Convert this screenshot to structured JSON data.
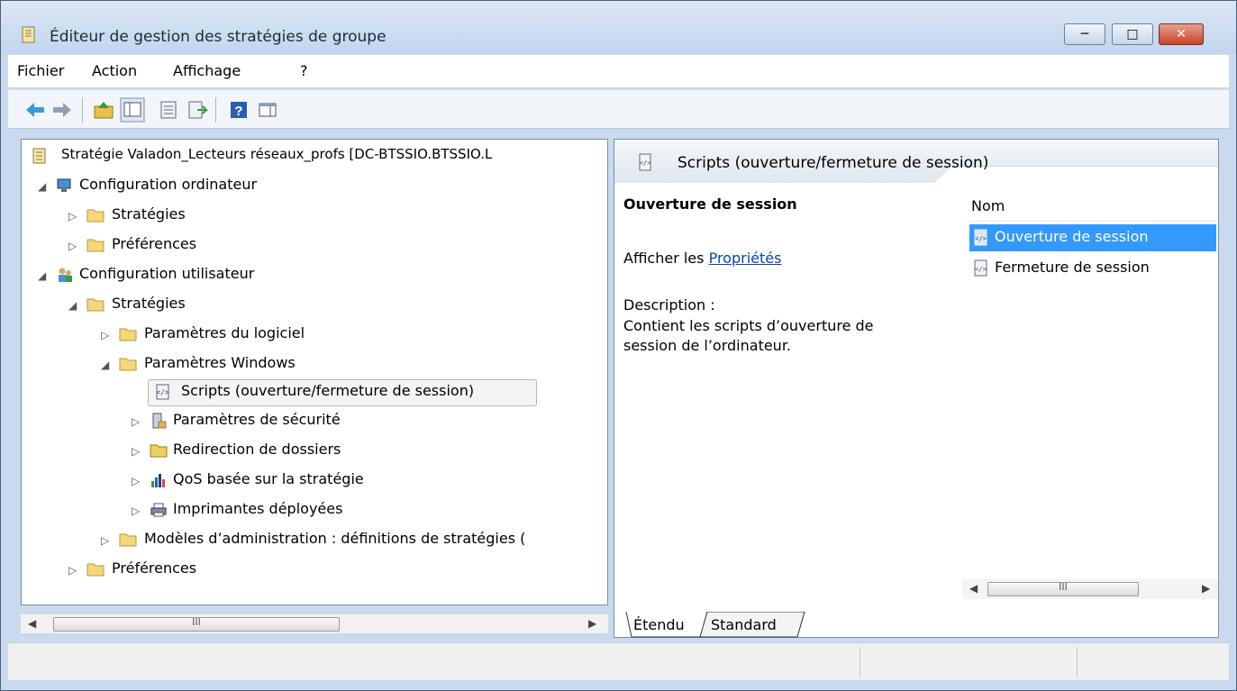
{
  "window": {
    "title": "Éditeur de gestion des stratégies de groupe",
    "controls": {
      "minimize": "─",
      "maximize": "□",
      "close": "✕"
    }
  },
  "menu": [
    "Fichier",
    "Action",
    "Affichage",
    "?"
  ],
  "toolbar": {
    "icons": [
      "back-arrow-icon",
      "forward-arrow-icon",
      "up-folder-icon",
      "show-hide-tree-icon",
      "properties-icon",
      "export-list-icon",
      "help-icon",
      "show-hide-action-pane-icon"
    ]
  },
  "tree": {
    "root": "Stratégie Valadon_Lecteurs réseaux_profs [DC-BTSSIO.BTSSIO.L",
    "nodes": [
      {
        "label": "Configuration ordinateur",
        "icon": "computer-config-icon",
        "expanded": true,
        "depth": 1
      },
      {
        "label": "Stratégies",
        "icon": "folder-icon",
        "expanded": false,
        "depth": 2
      },
      {
        "label": "Préférences",
        "icon": "folder-icon",
        "expanded": false,
        "depth": 2
      },
      {
        "label": "Configuration utilisateur",
        "icon": "user-config-icon",
        "expanded": true,
        "depth": 1
      },
      {
        "label": "Stratégies",
        "icon": "folder-icon",
        "expanded": true,
        "depth": 2
      },
      {
        "label": "Paramètres du logiciel",
        "icon": "folder-icon",
        "expanded": false,
        "depth": 3
      },
      {
        "label": "Paramètres Windows",
        "icon": "folder-icon",
        "expanded": true,
        "depth": 3
      },
      {
        "label": "Scripts (ouverture/fermeture de session)",
        "icon": "script-icon",
        "selected": true,
        "depth": 4
      },
      {
        "label": "Paramètres de sécurité",
        "icon": "security-icon",
        "expanded": false,
        "depth": 4
      },
      {
        "label": "Redirection de dossiers",
        "icon": "folder-icon",
        "expanded": false,
        "depth": 4
      },
      {
        "label": "QoS basée sur la stratégie",
        "icon": "chart-icon",
        "expanded": false,
        "depth": 4
      },
      {
        "label": "Imprimantes déployées",
        "icon": "printer-icon",
        "expanded": false,
        "depth": 4
      },
      {
        "label": "Modèles d’administration : définitions de stratégies (",
        "icon": "folder-icon",
        "expanded": false,
        "depth": 3
      },
      {
        "label": "Préférences",
        "icon": "folder-icon",
        "expanded": false,
        "depth": 2
      }
    ]
  },
  "details": {
    "header_title": "Scripts (ouverture/fermeture de session)",
    "section_title": "Ouverture de session",
    "show_prefix": "Afficher les ",
    "properties_link": "Propriétés ",
    "description_label": "Description :",
    "description_text": "Contient les scripts d’ouverture de session de l’ordinateur.",
    "column_header": "Nom",
    "items": [
      {
        "label": "Ouverture de session",
        "selected": true
      },
      {
        "label": "Fermeture de session",
        "selected": false
      }
    ]
  },
  "tabs": [
    "Étendu",
    "Standard"
  ],
  "scrollbar": {
    "grip": "III"
  },
  "colors": {
    "selection": "#3399ff",
    "header_blue": "#8ea6c4",
    "link": "#0645ad"
  }
}
